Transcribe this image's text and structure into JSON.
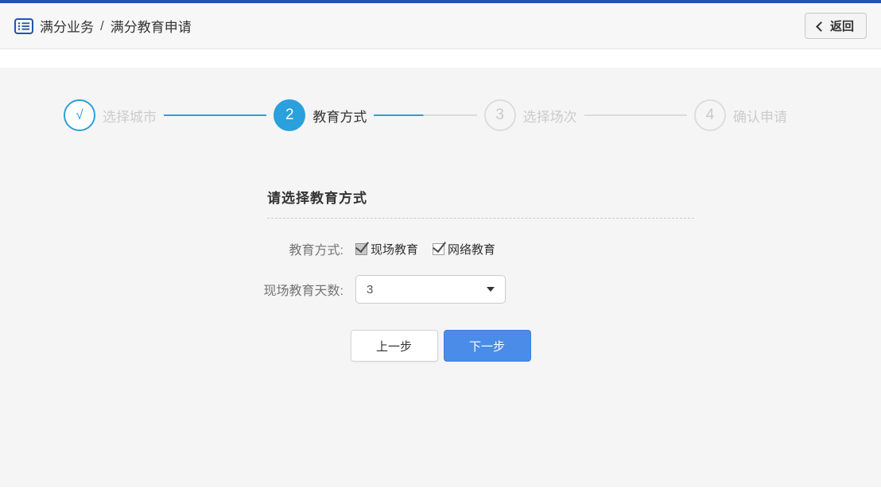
{
  "header": {
    "breadcrumb": {
      "root": "满分业务",
      "separator": "/",
      "current": "满分教育申请"
    },
    "back_button_label": "返回"
  },
  "stepper": {
    "steps": [
      {
        "number": "√",
        "label": "选择城市",
        "state": "done"
      },
      {
        "number": "2",
        "label": "教育方式",
        "state": "active"
      },
      {
        "number": "3",
        "label": "选择场次",
        "state": "pending"
      },
      {
        "number": "4",
        "label": "确认申请",
        "state": "pending"
      }
    ]
  },
  "form": {
    "title": "请选择教育方式",
    "rows": [
      {
        "label": "教育方式:",
        "type": "checkbox-group",
        "options": [
          {
            "label": "现场教育",
            "checked": true,
            "disabled": true
          },
          {
            "label": "网络教育",
            "checked": true,
            "disabled": false
          }
        ]
      },
      {
        "label": "现场教育天数:",
        "type": "select",
        "value": "3"
      }
    ],
    "buttons": {
      "previous": "上一步",
      "next": "下一步"
    }
  },
  "icons": {
    "header": "list-icon",
    "back": "chevron-left-icon",
    "select": "caret-down-icon"
  },
  "colors": {
    "top_bar": "#2057ae",
    "step_active": "#2aa0dc",
    "next_button": "#4a8ce8",
    "panel_bg": "#f5f5f5"
  }
}
